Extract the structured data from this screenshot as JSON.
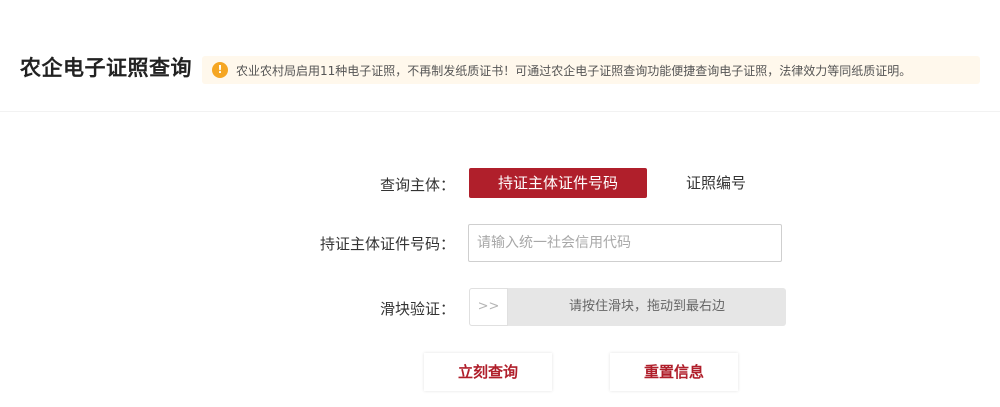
{
  "header": {
    "title": "农企电子证照查询",
    "notice_icon": "!",
    "notice": "农业农村局启用11种电子证照，不再制发纸质证书！可通过农企电子证照查询功能便捷查询电子证照，法律效力等同纸质证明。"
  },
  "form": {
    "subject_label": "查询主体：",
    "tabs": [
      {
        "label": "持证主体证件号码",
        "active": true
      },
      {
        "label": "证照编号",
        "active": false
      }
    ],
    "id_label": "持证主体证件号码：",
    "id_input": {
      "value": "",
      "placeholder": "请输入统一社会信用代码"
    },
    "slider_label": "滑块验证：",
    "slider": {
      "handle": ">>",
      "text": "请按住滑块，拖动到最右边"
    }
  },
  "buttons": {
    "query": "立刻查询",
    "reset": "重置信息"
  },
  "colors": {
    "brand_red": "#b01f2b",
    "notice_bg": "#fff8ec",
    "notice_icon": "#f5a623"
  }
}
